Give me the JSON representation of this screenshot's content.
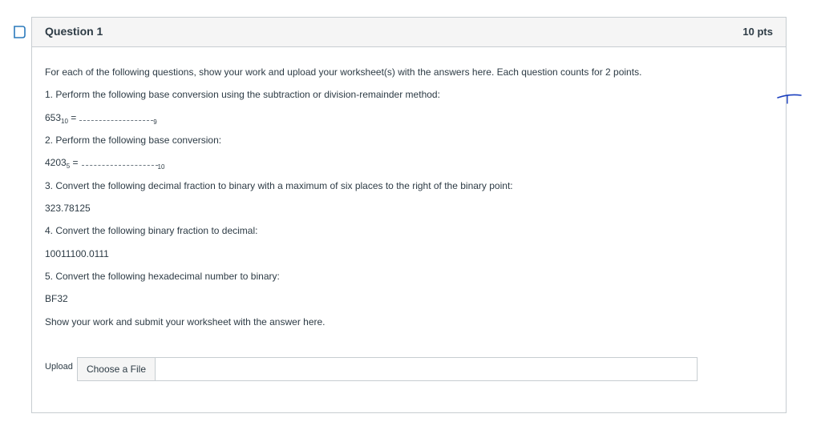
{
  "question": {
    "title": "Question 1",
    "points": "10 pts",
    "intro": "For each of the following questions, show your work and upload your worksheet(s) with the answers here. Each question counts for 2 points.",
    "items": [
      {
        "prompt": "1. Perform the following base conversion using the subtraction or division-remainder method:",
        "expr_value": "653",
        "expr_base": "10",
        "expr_eq": " =",
        "target_base": "9"
      },
      {
        "prompt": "2. Perform the following base conversion:",
        "expr_value": "4203",
        "expr_base": "5",
        "expr_eq": " =",
        "target_base": "10"
      },
      {
        "prompt": "3. Convert the following decimal fraction to binary with a maximum of six places to the right of the binary point:",
        "value": "323.78125"
      },
      {
        "prompt": "4. Convert the following binary fraction to decimal:",
        "value": "10011100.0111"
      },
      {
        "prompt": "5. Convert the following hexadecimal number to binary:",
        "value": "BF32"
      }
    ],
    "closing": "Show your work and submit your worksheet with the answer here.",
    "upload": {
      "label": "Upload",
      "button_label": "Choose a File"
    }
  },
  "colors": {
    "accent": "#2b7abc",
    "border": "#c7cdd1",
    "header_bg": "#f5f5f5",
    "text": "#2d3b45",
    "annotation": "#1a3fbf"
  },
  "icons": {
    "flag": "bookmark-flag-icon"
  }
}
